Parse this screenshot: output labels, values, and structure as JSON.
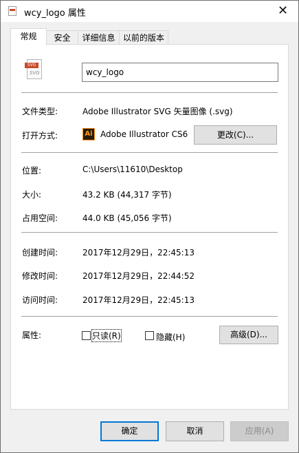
{
  "window": {
    "title": "wcy_logo 属性",
    "close_glyph": "✕"
  },
  "tabs": [
    "常规",
    "安全",
    "详细信息",
    "以前的版本"
  ],
  "general": {
    "file_name": "wcy_logo",
    "icon_text": "SVG",
    "file_type_label": "文件类型:",
    "file_type_value": "Adobe Illustrator SVG 矢量图像 (.svg)",
    "opens_with_label": "打开方式:",
    "opens_with_app": "Adobe Illustrator CS6",
    "app_icon_text": "Ai",
    "change_button": "更改(C)...",
    "location_label": "位置:",
    "location_value": "C:\\Users\\11610\\Desktop",
    "size_label": "大小:",
    "size_value": "43.2 KB (44,317 字节)",
    "size_on_disk_label": "占用空间:",
    "size_on_disk_value": "44.0 KB (45,056 字节)",
    "created_label": "创建时间:",
    "created_value": "2017年12月29日，22:45:13",
    "modified_label": "修改时间:",
    "modified_value": "2017年12月29日，22:44:52",
    "accessed_label": "访问时间:",
    "accessed_value": "2017年12月29日，22:45:13",
    "attributes_label": "属性:",
    "readonly_label": "只读(R)",
    "readonly_checked": false,
    "hidden_label": "隐藏(H)",
    "hidden_checked": false,
    "advanced_button": "高级(D)..."
  },
  "footer": {
    "ok": "确定",
    "cancel": "取消",
    "apply": "应用(A)"
  },
  "colors": {
    "accent": "#0078d7",
    "window_bg": "#f0f0f0",
    "panel_bg": "#ffffff"
  }
}
